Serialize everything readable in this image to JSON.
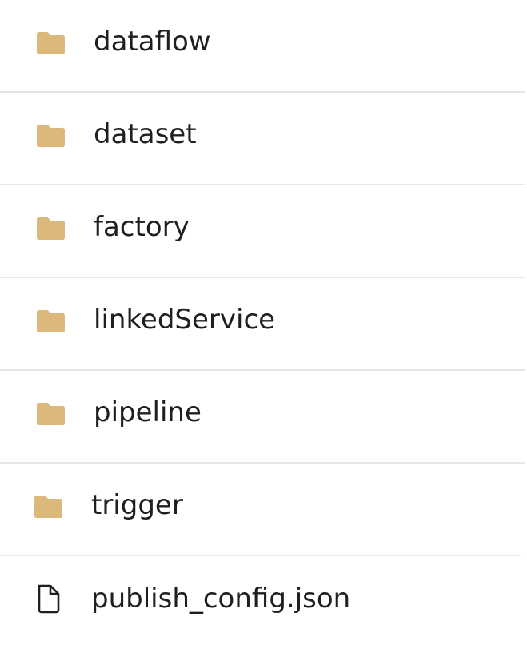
{
  "entries": [
    {
      "name": "dataflow",
      "type": "folder",
      "icon": "folder-icon"
    },
    {
      "name": "dataset",
      "type": "folder",
      "icon": "folder-icon"
    },
    {
      "name": "factory",
      "type": "folder",
      "icon": "folder-icon"
    },
    {
      "name": "linkedService",
      "type": "folder",
      "icon": "folder-icon"
    },
    {
      "name": "pipeline",
      "type": "folder",
      "icon": "folder-icon"
    },
    {
      "name": "trigger",
      "type": "folder",
      "icon": "folder-icon"
    },
    {
      "name": "publish_config.json",
      "type": "file",
      "icon": "file-icon"
    }
  ],
  "colors": {
    "folder": "#dcb97a",
    "text": "#1f1f1f",
    "divider": "#e6e6e6",
    "file_outline": "#1f1f1f"
  }
}
